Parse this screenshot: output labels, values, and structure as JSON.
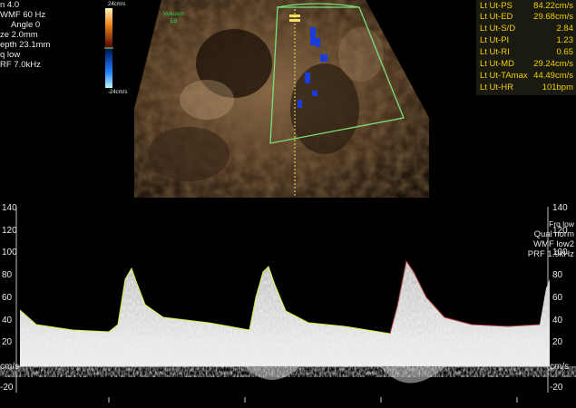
{
  "left_params": [
    "n 4.0",
    "WMF 60 Hz",
    "Angle 0",
    "ze 2.0mm",
    "epth 23.1mm",
    "q low",
    "RF 7.0kHz"
  ],
  "color_scale": {
    "top": "24cm/s",
    "bottom": "-24cm/s"
  },
  "brand": {
    "line1": "Voluson",
    "line2": "E8"
  },
  "measurements": [
    {
      "label": "Lt Ut-PS",
      "value": "84.22cm/s"
    },
    {
      "label": "Lt Ut-ED",
      "value": "29.68cm/s"
    },
    {
      "label": "Lt Ut-S/D",
      "value": "2.84"
    },
    {
      "label": "Lt Ut-PI",
      "value": "1.23"
    },
    {
      "label": "Lt Ut-RI",
      "value": "0.65"
    },
    {
      "label": "Lt Ut-MD",
      "value": "29.24cm/s"
    },
    {
      "label": "Lt Ut-TAmax",
      "value": "44.49cm/s"
    },
    {
      "label": "Lt Ut-HR",
      "value": "101bpm"
    }
  ],
  "right_params": [
    "Frq low",
    "Qual norm",
    "WMF low2",
    "PRF 1.9kHz"
  ],
  "scale_left": [
    "140",
    "120",
    "100",
    "80",
    "60",
    "40",
    "20",
    "cm/s",
    "-20"
  ],
  "scale_right": [
    "140",
    "120",
    "100",
    "80",
    "60",
    "40",
    "20",
    "cm/s",
    "-20"
  ],
  "colors": {
    "measure_text": "#f0d000",
    "roi_box": "#7be07b",
    "trace": "#d8f040",
    "brand": "#2fcf4f"
  }
}
